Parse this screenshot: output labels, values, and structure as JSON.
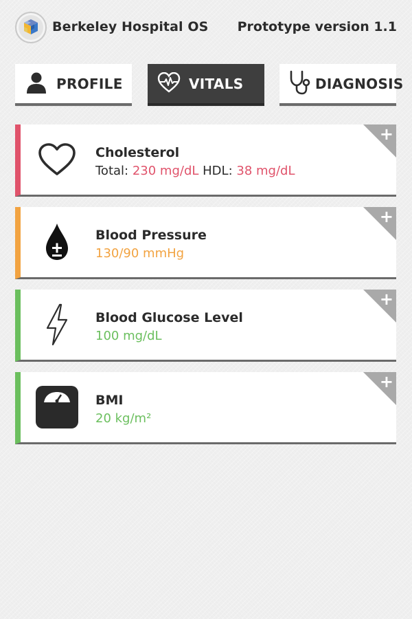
{
  "header": {
    "app_title": "Berkeley Hospital OS",
    "version": "Prototype version 1.1",
    "logo_icon": "hospital-cube-logo"
  },
  "tabs": [
    {
      "label": "PROFILE",
      "icon": "person-icon",
      "active": false
    },
    {
      "label": "VITALS",
      "icon": "heartbeat-icon",
      "active": true
    },
    {
      "label": "DIAGNOSIS",
      "icon": "stethoscope-icon",
      "active": false
    }
  ],
  "vitals": [
    {
      "title": "Cholesterol",
      "icon": "heart-icon",
      "accent": "#e0536b",
      "total_label": "Total:",
      "total_value": "230 mg/dL",
      "hdl_label": "HDL:",
      "hdl_value": "38 mg/dL"
    },
    {
      "title": "Blood Pressure",
      "icon": "blood-drop-icon",
      "accent": "#f2a341",
      "value": "130/90 mmHg"
    },
    {
      "title": "Blood Glucose Level",
      "icon": "lightning-icon",
      "accent": "#6bbf5e",
      "value": "100 mg/dL"
    },
    {
      "title": "BMI",
      "icon": "scale-icon",
      "accent": "#6bbf5e",
      "value": "20 kg/m²"
    }
  ],
  "card_action": {
    "plus": "+"
  },
  "colors": {
    "active_tab": "#3e3e3e",
    "red": "#e0536b",
    "orange": "#f2a341",
    "green": "#6bbf5e"
  }
}
